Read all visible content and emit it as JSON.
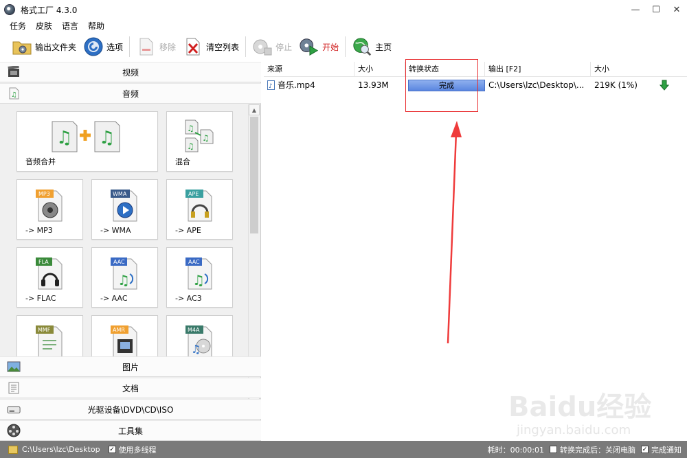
{
  "window": {
    "title": "格式工厂 4.3.0",
    "controls": [
      "—",
      "☐",
      "✕"
    ]
  },
  "menu": [
    "任务",
    "皮肤",
    "语言",
    "帮助"
  ],
  "toolbar": {
    "output_folder": "输出文件夹",
    "options": "选项",
    "remove": "移除",
    "clear_list": "清空列表",
    "stop": "停止",
    "start": "开始",
    "home": "主页"
  },
  "categories": {
    "video": "视频",
    "audio": "音频",
    "image": "图片",
    "document": "文档",
    "optical": "光驱设备\\DVD\\CD\\ISO",
    "tools": "工具集"
  },
  "audio_tiles": [
    {
      "label": "音频合并",
      "badge": ""
    },
    {
      "label": "混合",
      "badge": ""
    },
    {
      "label": "-> MP3",
      "badge": "MP3"
    },
    {
      "label": "-> WMA",
      "badge": "WMA"
    },
    {
      "label": "-> APE",
      "badge": "APE"
    },
    {
      "label": "-> FLAC",
      "badge": "FLA"
    },
    {
      "label": "-> AAC",
      "badge": "AAC"
    },
    {
      "label": "-> AC3",
      "badge": "AAC"
    },
    {
      "label": "",
      "badge": "MMF"
    },
    {
      "label": "",
      "badge": "AMR"
    },
    {
      "label": "",
      "badge": "M4A"
    }
  ],
  "list": {
    "headers": [
      "来源",
      "大小",
      "转换状态",
      "输出 [F2]",
      "大小"
    ],
    "rows": [
      {
        "source": "音乐.mp4",
        "size": "13.93M",
        "status": "完成",
        "output": "C:\\Users\\lzc\\Desktop\\...",
        "out_size": "219K  (1%)"
      }
    ]
  },
  "statusbar": {
    "path": "C:\\Users\\lzc\\Desktop",
    "multithread": "使用多线程",
    "elapsed": "耗时：00:00:01",
    "after_convert": "转换完成后：关闭电脑",
    "notify": "完成通知"
  },
  "watermark": {
    "brand": "Baidu经验",
    "sub": "jingyan.baidu.com"
  },
  "colors": {
    "annotation": "#e8282b",
    "status_fill": "#5a86e0",
    "statusbar_bg": "#7a7a7a"
  }
}
